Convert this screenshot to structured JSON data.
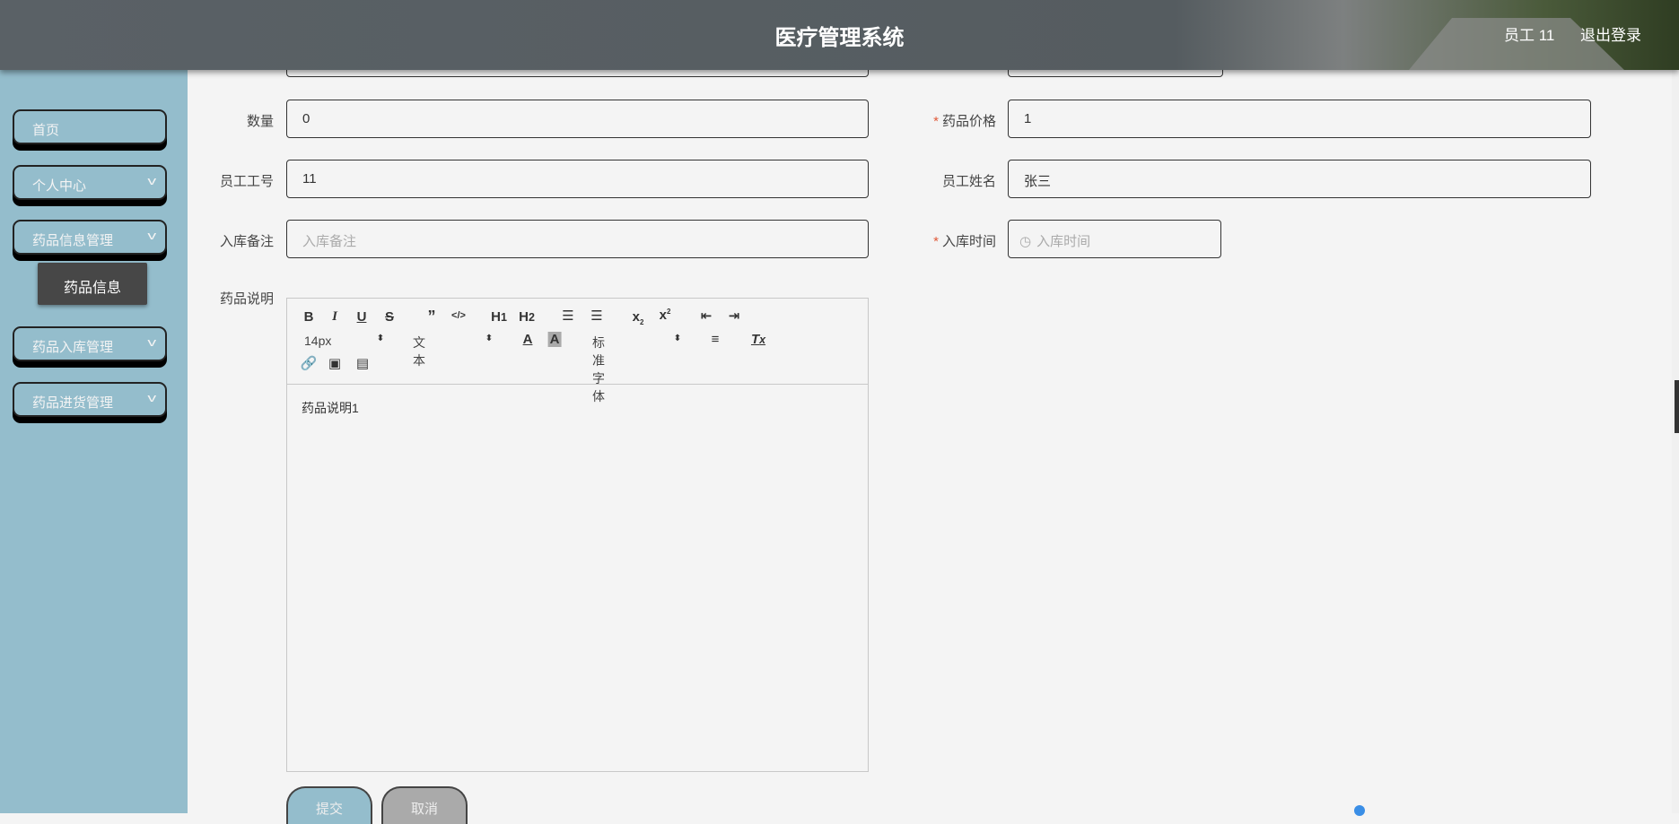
{
  "header": {
    "title": "医疗管理系统",
    "user": "员工 11",
    "logout": "退出登录"
  },
  "sidebar": {
    "items": [
      {
        "label": "首页"
      },
      {
        "label": "个人中心"
      },
      {
        "label": "药品信息管理"
      },
      {
        "label": "药品入库管理"
      },
      {
        "label": "药品进货管理"
      }
    ],
    "submenu": {
      "label": "药品信息"
    }
  },
  "form": {
    "quantity": {
      "label": "数量",
      "value": "0"
    },
    "price": {
      "label": "药品价格",
      "value": "1",
      "required": "*"
    },
    "staff_id": {
      "label": "员工工号",
      "value": "11"
    },
    "staff_name": {
      "label": "员工姓名",
      "value": "张三"
    },
    "remark": {
      "label": "入库备注",
      "placeholder": "入库备注"
    },
    "time": {
      "label": "入库时间",
      "placeholder": "入库时间",
      "required": "*"
    },
    "desc": {
      "label": "药品说明",
      "content": "药品说明1"
    }
  },
  "editor": {
    "font_size": "14px",
    "heading": "文本",
    "font_family": "标准字体"
  },
  "buttons": {
    "submit": "提交",
    "cancel": "取消"
  }
}
